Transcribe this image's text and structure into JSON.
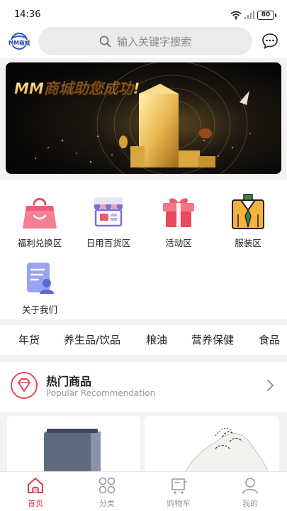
{
  "status_bar": {
    "time": "14:36",
    "battery": "80"
  },
  "header": {
    "logo_text": "MM商城",
    "search_placeholder": "输入关键字搜索"
  },
  "banner": {
    "text": "MM商城助您成功!"
  },
  "categories": [
    {
      "label": "福利兑换区",
      "icon": "shopping-bag-icon"
    },
    {
      "label": "日用百货区",
      "icon": "storefront-icon"
    },
    {
      "label": "活动区",
      "icon": "gift-icon"
    },
    {
      "label": "服装区",
      "icon": "shirt-icon"
    },
    {
      "label": "关于我们",
      "icon": "profile-document-icon"
    }
  ],
  "tabs": [
    "年货",
    "养生品/饮品",
    "粮油",
    "营养保健",
    "食品"
  ],
  "hot": {
    "title": "热门商品",
    "subtitle": "Popular Recommendation"
  },
  "bottom_nav": [
    {
      "label": "首页",
      "icon": "home-icon",
      "active": true
    },
    {
      "label": "分类",
      "icon": "grid-icon",
      "active": false
    },
    {
      "label": "购物车",
      "icon": "cart-icon",
      "active": false
    },
    {
      "label": "我的",
      "icon": "user-icon",
      "active": false
    }
  ],
  "colors": {
    "accent": "#d8384b",
    "background": "#f2f2f2"
  }
}
